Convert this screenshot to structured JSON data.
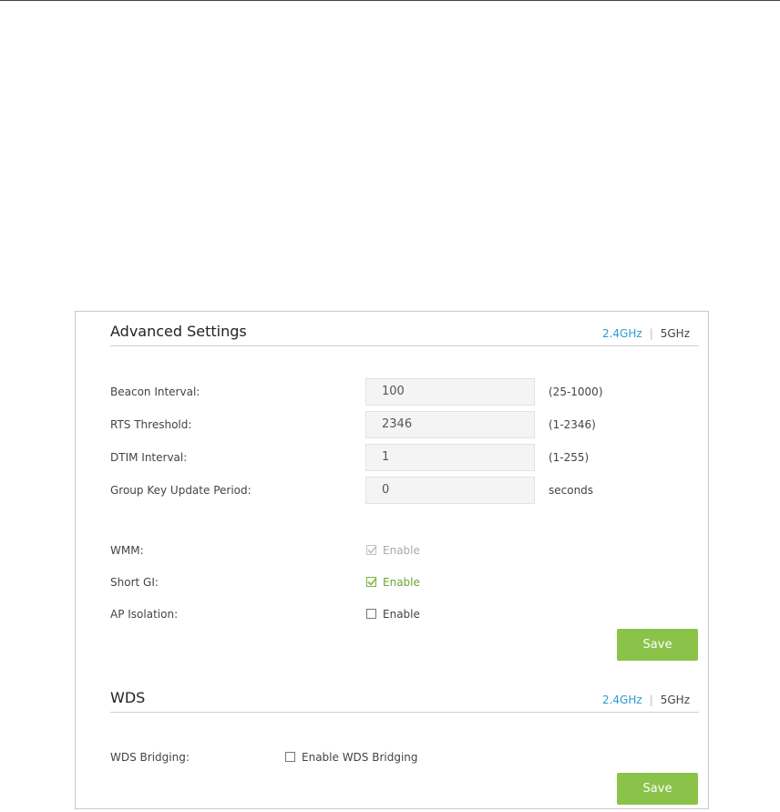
{
  "advanced": {
    "title": "Advanced Settings",
    "band_active": "2.4GHz",
    "band_sep": "|",
    "band_other": "5GHz",
    "fields": [
      {
        "label": "Beacon Interval:",
        "value": "100",
        "hint": "(25-1000)"
      },
      {
        "label": "RTS Threshold:",
        "value": "2346",
        "hint": "(1-2346)"
      },
      {
        "label": "DTIM Interval:",
        "value": "1",
        "hint": "(1-255)"
      },
      {
        "label": "Group Key Update Period:",
        "value": "0",
        "hint": "seconds"
      }
    ],
    "checks": [
      {
        "label": "WMM:",
        "text": "Enable",
        "checked": true,
        "state": "disabled"
      },
      {
        "label": "Short GI:",
        "text": "Enable",
        "checked": true,
        "state": "active"
      },
      {
        "label": "AP Isolation:",
        "text": "Enable",
        "checked": false,
        "state": "normal"
      }
    ],
    "save_label": "Save"
  },
  "wds": {
    "title": "WDS",
    "band_active": "2.4GHz",
    "band_sep": "|",
    "band_other": "5GHz",
    "bridging_label": "WDS Bridging:",
    "bridging_text": "Enable WDS Bridging",
    "save_label": "Save"
  },
  "colors": {
    "accent": "#2a9bd0",
    "button": "#8bc34a",
    "check_active": "#7cb342"
  }
}
